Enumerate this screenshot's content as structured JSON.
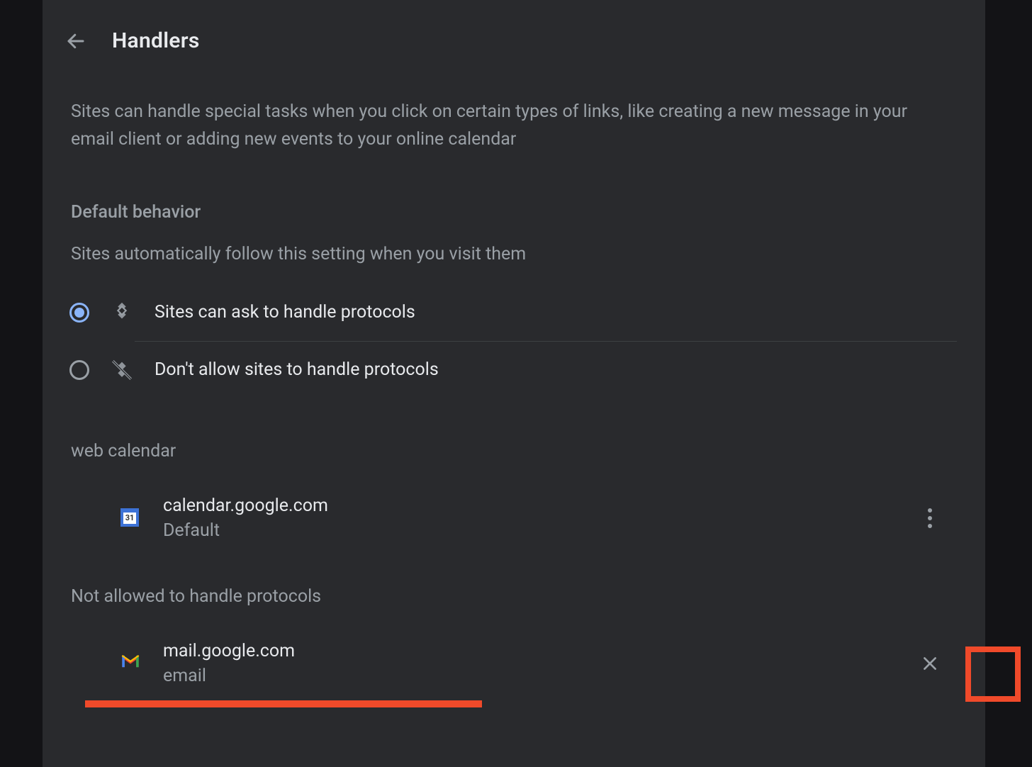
{
  "header": {
    "title": "Handlers"
  },
  "description": "Sites can handle special tasks when you click on certain types of links, like creating a new message in your email client or adding new events to your online calendar",
  "defaultBehavior": {
    "heading": "Default behavior",
    "subheading": "Sites automatically follow this setting when you visit them",
    "options": {
      "allow": {
        "label": "Sites can ask to handle protocols",
        "selected": true
      },
      "block": {
        "label": "Don't allow sites to handle protocols",
        "selected": false
      }
    }
  },
  "categories": {
    "webCalendar": {
      "heading": "web calendar",
      "site": {
        "name": "calendar.google.com",
        "sub": "Default"
      }
    },
    "notAllowed": {
      "heading": "Not allowed to handle protocols",
      "site": {
        "name": "mail.google.com",
        "sub": "email"
      }
    }
  }
}
